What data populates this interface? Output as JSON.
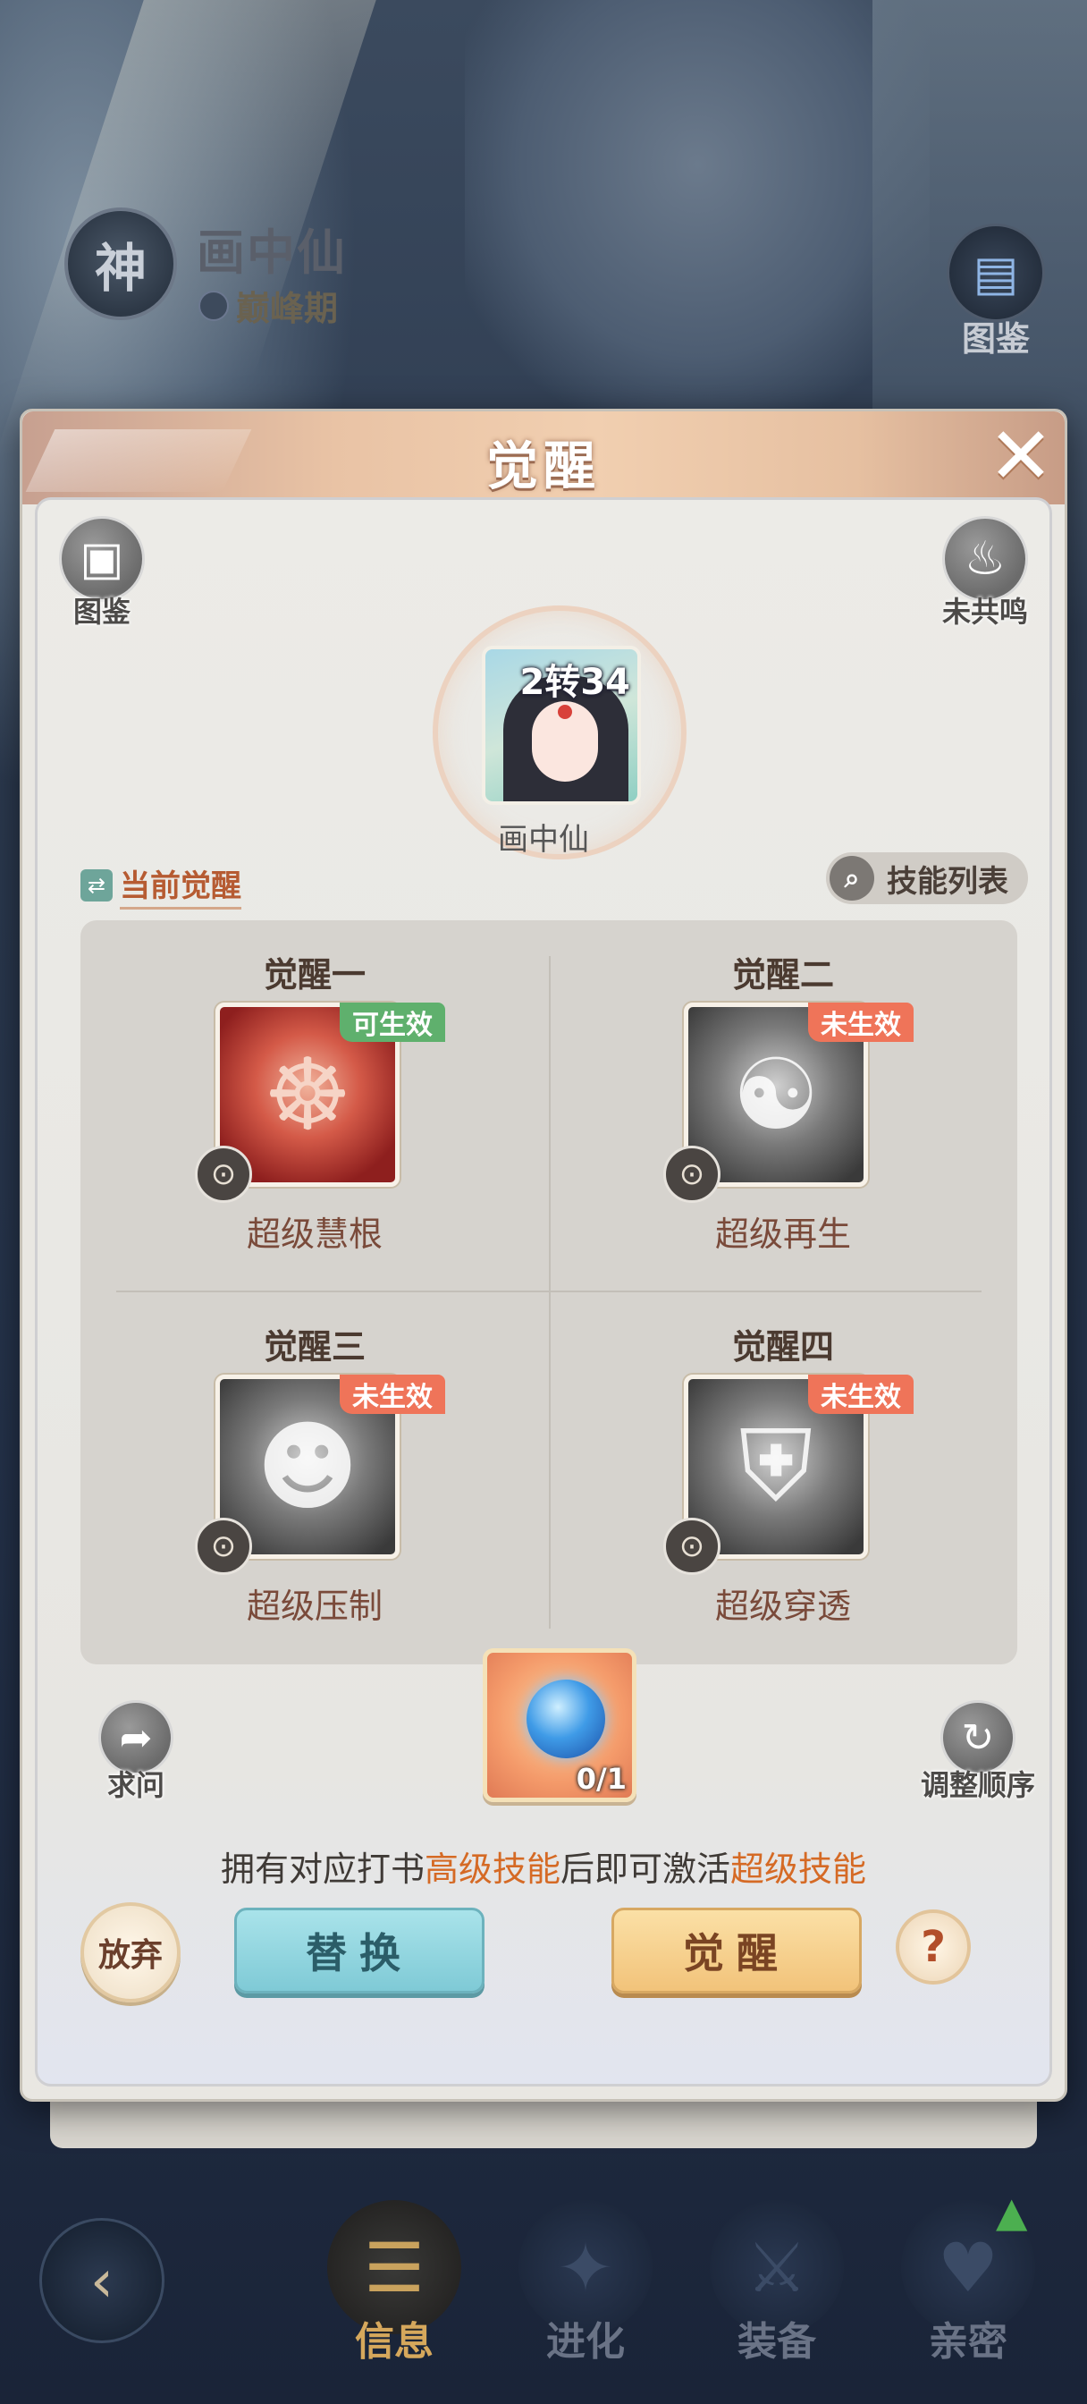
{
  "background": {
    "badge_glyph": "神",
    "character_name": "画中仙",
    "stage": "巅峰期",
    "side_button_label": "图鉴",
    "side_button_icon": "book-paw-icon"
  },
  "bottom_nav": {
    "back_icon": "back-arrow-icon",
    "items": [
      {
        "label": "信息",
        "icon": "scroll-icon",
        "active": true
      },
      {
        "label": "进化",
        "icon": "star-evolve-icon",
        "active": false
      },
      {
        "label": "装备",
        "icon": "equip-icon",
        "active": false
      },
      {
        "label": "亲密",
        "icon": "heart-icon",
        "active": false
      }
    ],
    "notify_icon": "arrow-up-icon"
  },
  "modal": {
    "title": "觉醒",
    "close_icon": "close-icon",
    "codex_label": "图鉴",
    "resonance_label": "未共鸣",
    "portrait": {
      "level": "2转34",
      "name": "画中仙"
    },
    "current_awaken_label": "当前觉醒",
    "skill_list_label": "技能列表",
    "slots": [
      {
        "title": "觉醒一",
        "tag": "可生效",
        "tag_state": "ok",
        "skill": "超级慧根",
        "icon": "brain-demon-icon",
        "style": "red"
      },
      {
        "title": "觉醒二",
        "tag": "未生效",
        "tag_state": "no",
        "skill": "超级再生",
        "icon": "meditate-icon",
        "style": "gray"
      },
      {
        "title": "觉醒三",
        "tag": "未生效",
        "tag_state": "no",
        "skill": "超级压制",
        "icon": "shadow-demon-icon",
        "style": "gray"
      },
      {
        "title": "觉醒四",
        "tag": "未生效",
        "tag_state": "no",
        "skill": "超级穿透",
        "icon": "broken-shield-icon",
        "style": "gray"
      }
    ],
    "ask_label": "求问",
    "reorder_label": "调整顺序",
    "item_count": "0/1",
    "hint_parts": [
      "拥有对应打书",
      "高级技能",
      "后即可激活",
      "超级技能"
    ],
    "abandon_label": "放弃",
    "replace_label": "替换",
    "awaken_label": "觉醒",
    "help_label": "?"
  }
}
